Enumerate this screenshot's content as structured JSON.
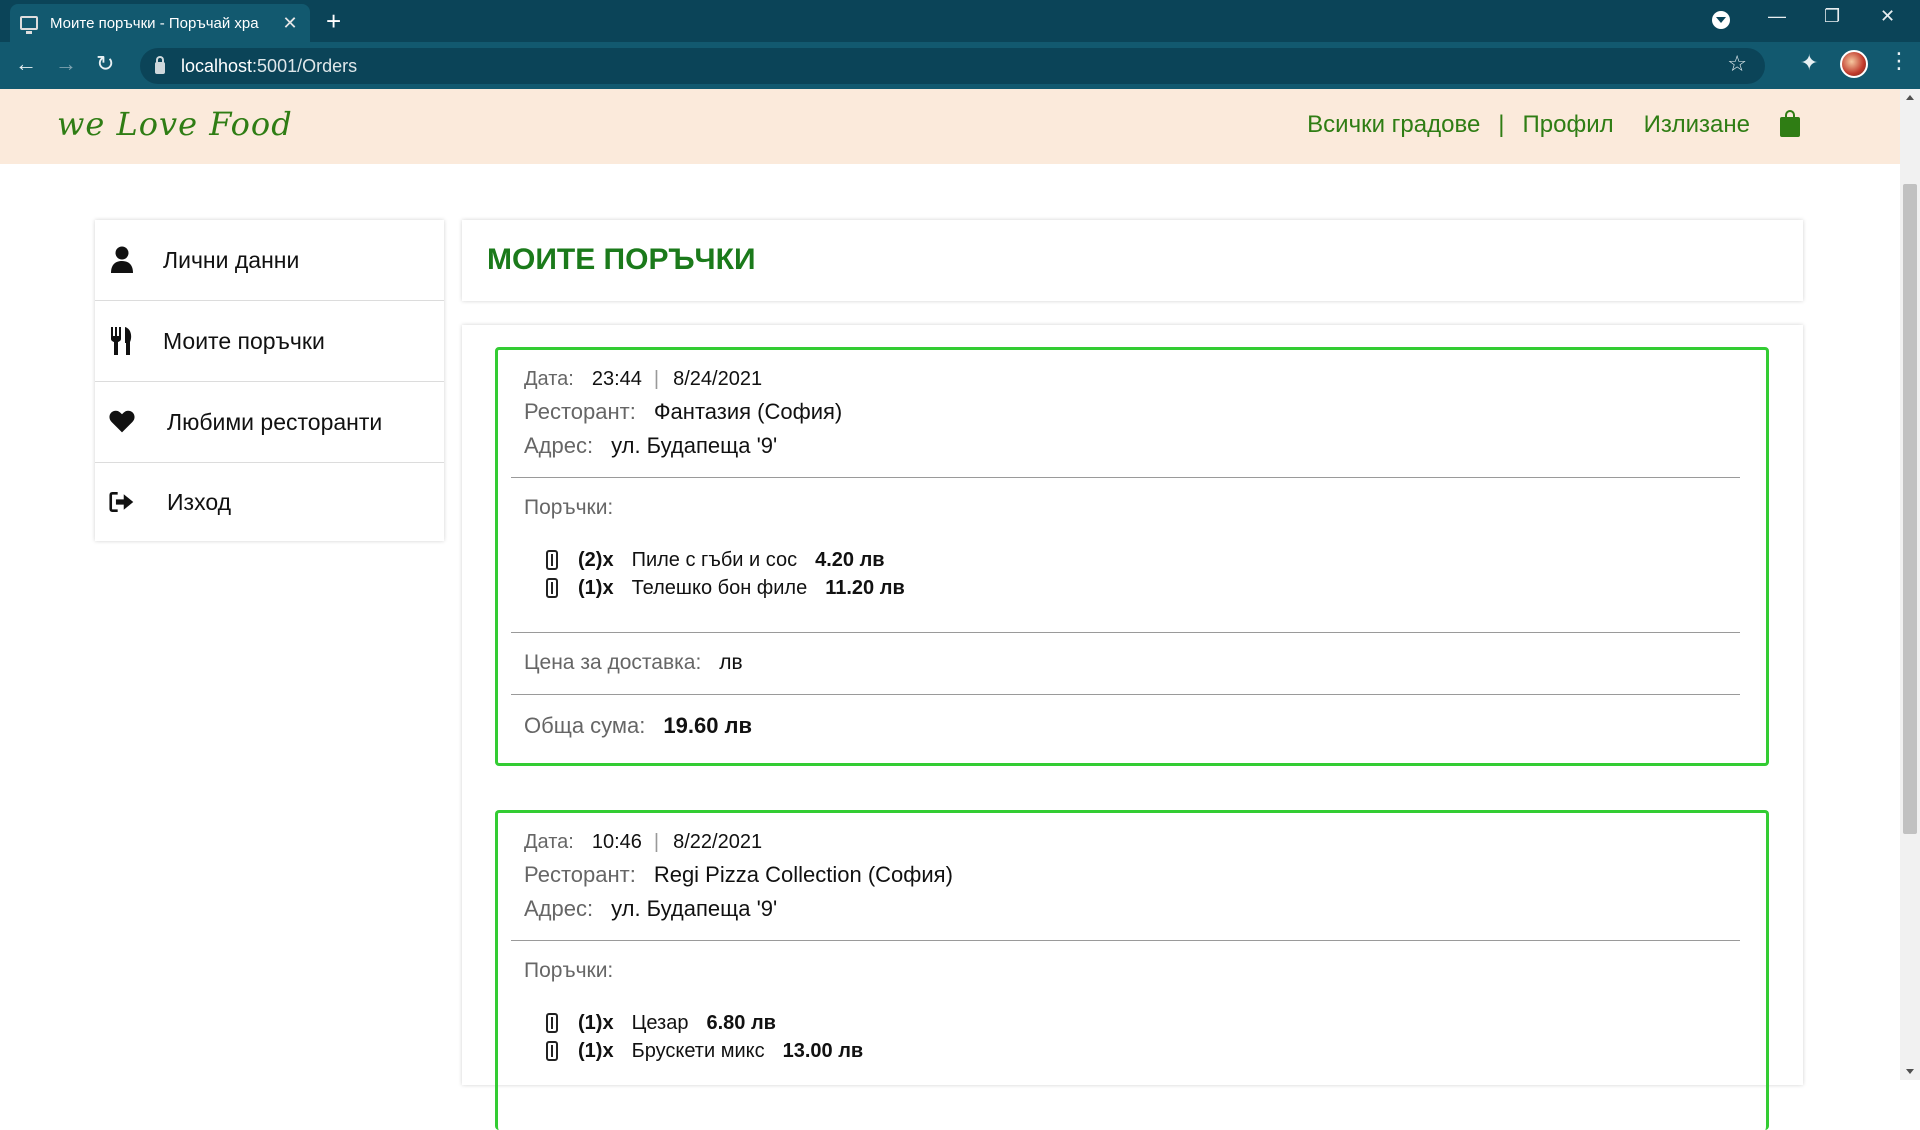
{
  "browser": {
    "tab_title": "Моите поръчки - Поръчай хра",
    "url_host": "localhost",
    "url_path": ":5001/Orders"
  },
  "site": {
    "logo": "we Love Food",
    "nav": {
      "cities": "Всички градове",
      "separator": "|",
      "profile": "Профил",
      "logout": "Излизане"
    }
  },
  "sidebar": {
    "items": [
      {
        "label": "Лични данни",
        "icon": "user-icon"
      },
      {
        "label": "Моите поръчки",
        "icon": "utensils-icon"
      },
      {
        "label": "Любими ресторанти",
        "icon": "heart-icon"
      },
      {
        "label": "Изход",
        "icon": "sign-out-icon"
      }
    ]
  },
  "page_title": "МОИТЕ ПОРЪЧКИ",
  "labels": {
    "date": "Дата:",
    "restaurant": "Ресторант:",
    "address": "Адрес:",
    "orders": "Поръчки:",
    "delivery": "Цена за доставка:",
    "total": "Обща сума:"
  },
  "orders": [
    {
      "time": "23:44",
      "date": "8/24/2021",
      "restaurant": "Фантазия (София)",
      "address": "ул. Будапеща '9'",
      "items": [
        {
          "qty": "(2)x",
          "name": "Пиле с гъби и сос",
          "price": "4.20 лв"
        },
        {
          "qty": "(1)x",
          "name": "Телешко бон филе",
          "price": "11.20 лв"
        }
      ],
      "delivery": "лв",
      "total": "19.60 лв"
    },
    {
      "time": "10:46",
      "date": "8/22/2021",
      "restaurant": "Regi Pizza Collection (София)",
      "address": "ул. Будапеща '9'",
      "items": [
        {
          "qty": "(1)x",
          "name": "Цезар",
          "price": "6.80 лв"
        },
        {
          "qty": "(1)x",
          "name": "Брускети микс",
          "price": "13.00 лв"
        }
      ]
    }
  ]
}
